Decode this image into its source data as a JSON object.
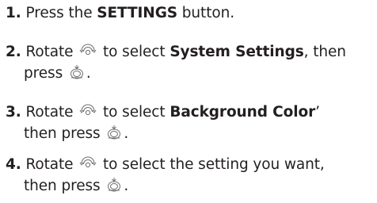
{
  "steps": [
    {
      "number": "1.",
      "pre": "Press the",
      "bold": "SETTINGS",
      "post": "button."
    },
    {
      "number": "2.",
      "verb": "Rotate",
      "select_text": "to select",
      "bold": "System Settings",
      "after_bold": ", then",
      "line2": "press",
      "end": "."
    },
    {
      "number": "3.",
      "verb": "Rotate",
      "select_text": "to select",
      "bold": "Background Color",
      "after_bold": "’",
      "line2": "then press",
      "end": "."
    },
    {
      "number": "4.",
      "verb": "Rotate",
      "line1_rest": "to select the setting you want,",
      "line2": "then press",
      "end": "."
    }
  ],
  "icons": {
    "rotate": "interface-dial-rotate-icon",
    "press": "interface-dial-press-icon"
  }
}
